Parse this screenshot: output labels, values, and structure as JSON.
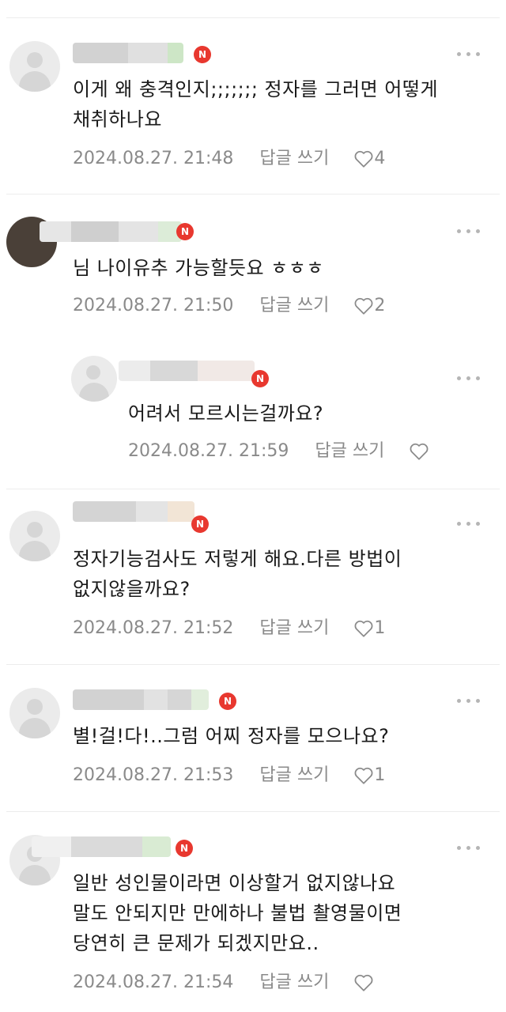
{
  "comments": [
    {
      "text_lines": [
        "이게 왜 충격인지;;;;;;; 정자를 그러면 어떻게",
        "채취하나요"
      ],
      "date": "2024.08.27. 21:48",
      "reply_label": "답글 쓰기",
      "like_count": "4",
      "badge": "N"
    },
    {
      "text_lines": [
        "님 나이유추 가능할듯요 ㅎㅎㅎ"
      ],
      "date": "2024.08.27. 21:50",
      "reply_label": "답글 쓰기",
      "like_count": "2",
      "badge": "N"
    },
    {
      "text_lines": [
        "어려서 모르시는걸까요?"
      ],
      "date": "2024.08.27. 21:59",
      "reply_label": "답글 쓰기",
      "like_count": "",
      "badge": "N"
    },
    {
      "text_lines": [
        "정자기능검사도 저렇게 해요.다른 방법이",
        "없지않을까요?"
      ],
      "date": "2024.08.27. 21:52",
      "reply_label": "답글 쓰기",
      "like_count": "1",
      "badge": "N"
    },
    {
      "text_lines": [
        "별!걸!다!..그럼 어찌 정자를 모으나요?"
      ],
      "date": "2024.08.27. 21:53",
      "reply_label": "답글 쓰기",
      "like_count": "1",
      "badge": "N"
    },
    {
      "text_lines": [
        "일반 성인물이라면 이상할거 없지않나요",
        "말도 안되지만 만에하나 불법 촬영물이면",
        "당연히 큰 문제가 되겠지만요.."
      ],
      "date": "2024.08.27. 21:54",
      "reply_label": "답글 쓰기",
      "like_count": "",
      "badge": "N"
    }
  ],
  "colors": {
    "badge": "#e8382f",
    "meta": "#8a8a8a",
    "text": "#1a1a1a"
  }
}
